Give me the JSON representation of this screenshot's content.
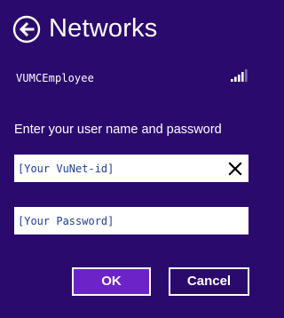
{
  "header": {
    "back_icon": "arrow-left-circle-icon",
    "title": "Networks"
  },
  "network": {
    "name": "VUMCEmployee",
    "signal_icon": "wifi-signal-bars-icon",
    "signal_bars_total": 5,
    "signal_bars_lit": 4
  },
  "credentials": {
    "prompt": "Enter your user name and password",
    "username": {
      "value": "[Your VuNet-id]",
      "clear_icon": "close-icon"
    },
    "password": {
      "value": "[Your Password]"
    }
  },
  "actions": {
    "ok_label": "OK",
    "cancel_label": "Cancel"
  },
  "colors": {
    "background": "#2b0a6e",
    "ok_button": "#6c23c7",
    "input_text": "#1f3f9c",
    "foreground": "#ffffff"
  }
}
